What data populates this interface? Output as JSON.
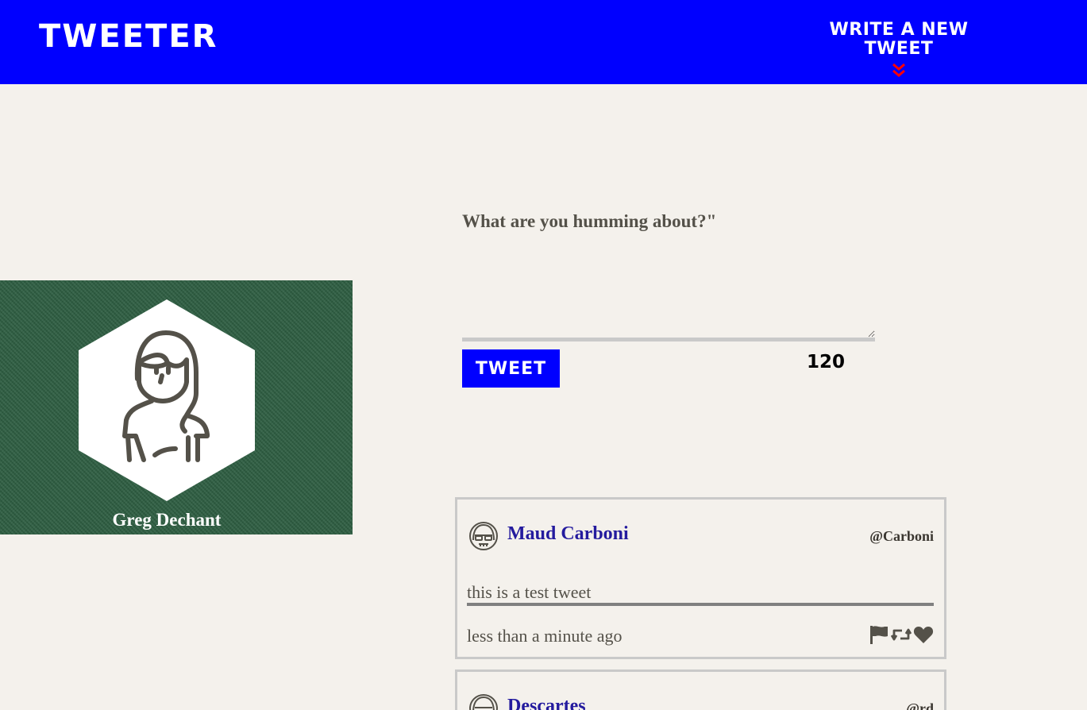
{
  "nav": {
    "brand": "TWEETER",
    "write_label": "WRITE A NEW TWEET",
    "chevron_color": "#ff0000"
  },
  "profile": {
    "name": "Greg Dechant"
  },
  "compose": {
    "title": "What are you humming about?\"",
    "button_label": "TWEET",
    "counter": "120"
  },
  "tweets": [
    {
      "name": "Maud Carboni",
      "handle": "@Carboni",
      "content": "this is a test tweet",
      "time": "less than a minute ago",
      "icons": [
        "flag-icon",
        "retweet-icon",
        "heart-icon"
      ]
    },
    {
      "name": "Descartes",
      "handle": "@rd"
    }
  ],
  "colors": {
    "nav_bg": "#0000ff",
    "page_bg": "#f4f1ec",
    "name_color": "#241b9e",
    "profile_bg": "#2c5c40"
  }
}
